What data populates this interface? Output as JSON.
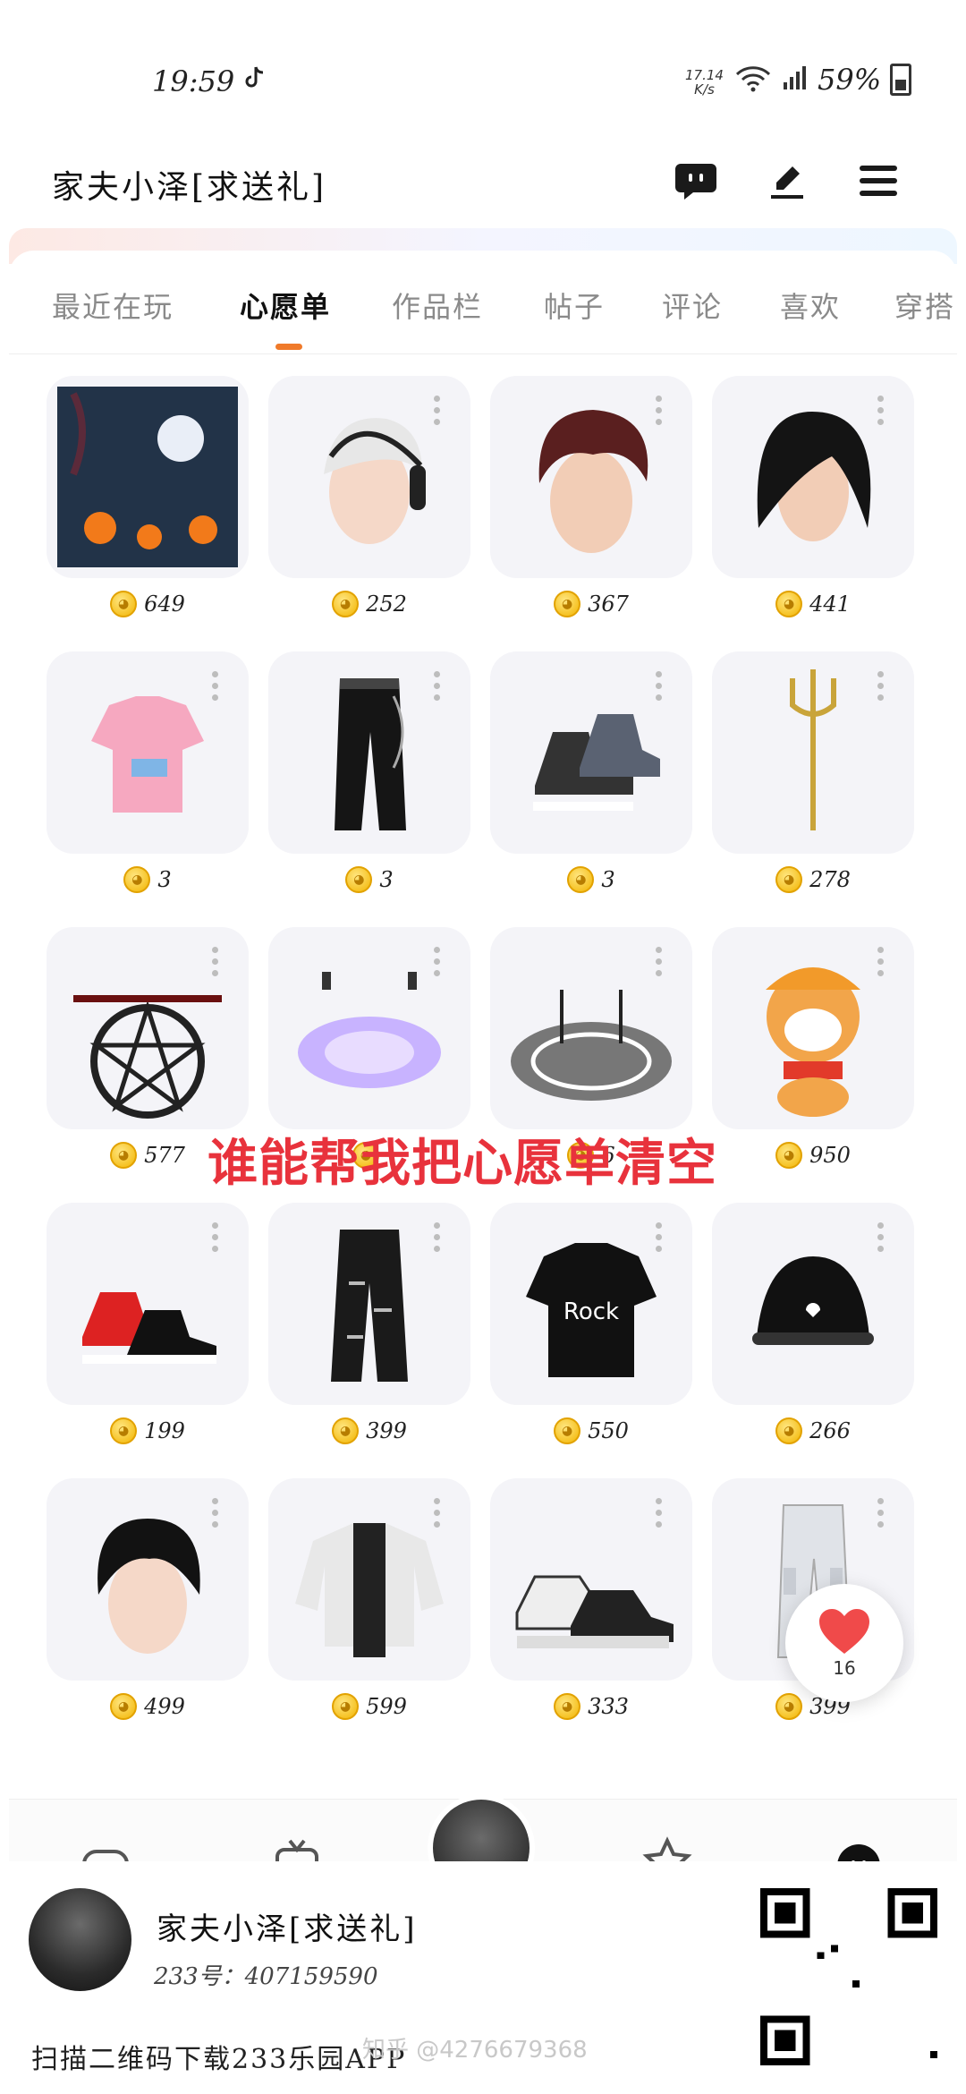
{
  "status_bar": {
    "time": "19:59",
    "net_speed_value": "17.14",
    "net_speed_unit": "K/s",
    "battery": "59%"
  },
  "header": {
    "title": "家夫小泽[求送礼]"
  },
  "tabs": [
    "最近在玩",
    "心愿单",
    "作品栏",
    "帖子",
    "评论",
    "喜欢",
    "穿搭"
  ],
  "active_tab": "心愿单",
  "wishlist": [
    {
      "icon": "halloween-scene",
      "price": "649"
    },
    {
      "icon": "white-hair-headphones",
      "price": "252"
    },
    {
      "icon": "brown-hair",
      "price": "367"
    },
    {
      "icon": "black-long-hair",
      "price": "441"
    },
    {
      "icon": "pink-shirt",
      "price": "3"
    },
    {
      "icon": "black-pants-chain",
      "price": "3"
    },
    {
      "icon": "sneaker-boots",
      "price": "3"
    },
    {
      "icon": "golden-trident",
      "price": "278"
    },
    {
      "icon": "dark-pentagram-drone",
      "price": "577"
    },
    {
      "icon": "purple-magic-circle",
      "price": ""
    },
    {
      "icon": "white-magic-circle",
      "price": "6"
    },
    {
      "icon": "shiba-dog",
      "price": "950"
    },
    {
      "icon": "red-sneakers",
      "price": "199"
    },
    {
      "icon": "black-ripped-pants",
      "price": "399"
    },
    {
      "icon": "rock-tshirt",
      "price": "550"
    },
    {
      "icon": "black-beanie",
      "price": "266"
    },
    {
      "icon": "black-short-hair",
      "price": "499"
    },
    {
      "icon": "white-jacket",
      "price": "599"
    },
    {
      "icon": "platform-sneakers",
      "price": "333"
    },
    {
      "icon": "white-cargo-pants",
      "price": "399"
    }
  ],
  "overlay_caption": "谁能帮我把心愿单清空",
  "like": {
    "count": "16"
  },
  "footer": {
    "name": "家夫小泽[求送礼]",
    "id_line": "233号：407159590",
    "scan_text": "扫描二维码下载233乐园APP",
    "watermark": "知乎 @4276679368"
  },
  "colors": {
    "accent": "#f07a2a",
    "overlay_red": "#e8323c",
    "coin": "#f2b400"
  }
}
